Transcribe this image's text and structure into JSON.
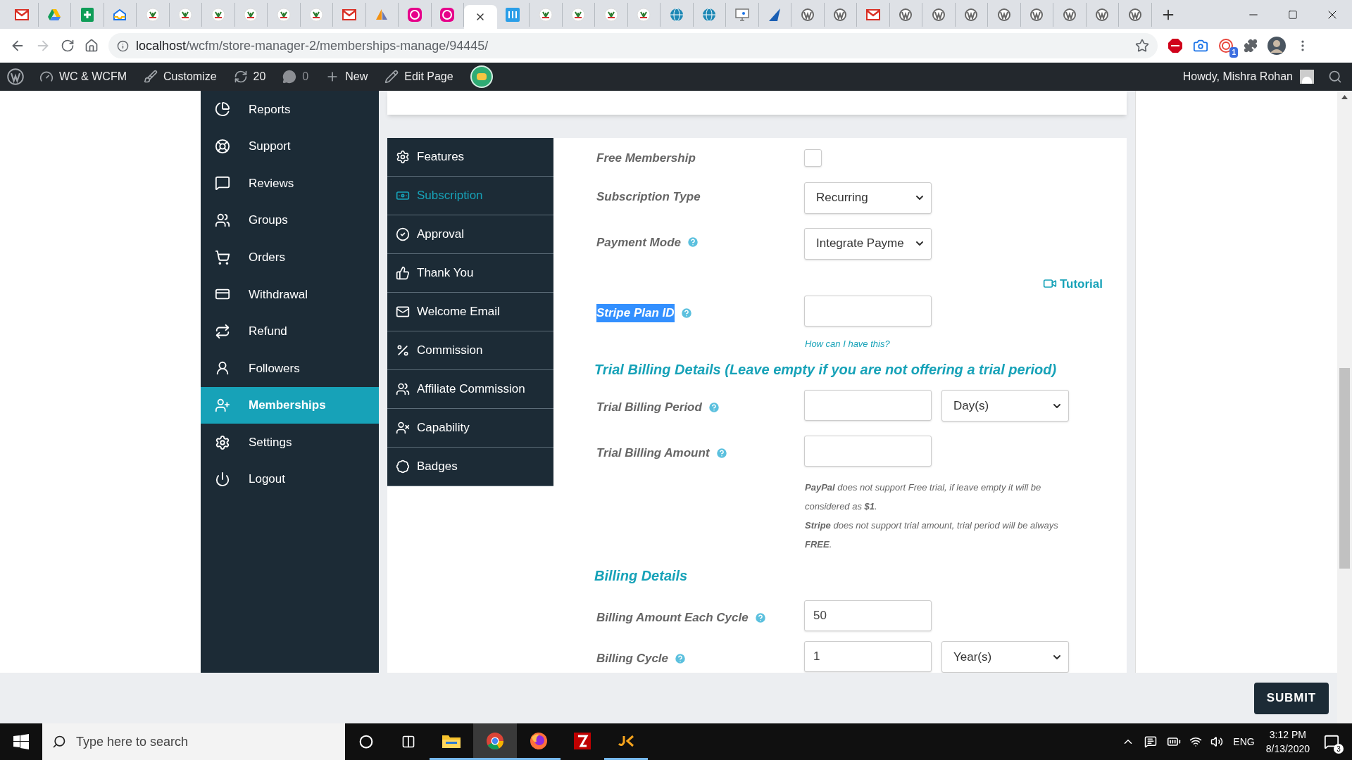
{
  "browser": {
    "tabs": [
      {
        "kind": "gmail",
        "selected": false
      },
      {
        "kind": "drive",
        "selected": false
      },
      {
        "kind": "sheets",
        "selected": false
      },
      {
        "kind": "inbox",
        "selected": false
      },
      {
        "kind": "wcfm",
        "selected": false
      },
      {
        "kind": "wcfm",
        "selected": false
      },
      {
        "kind": "wcfm",
        "selected": false
      },
      {
        "kind": "wcfm",
        "selected": false
      },
      {
        "kind": "wcfm",
        "selected": false
      },
      {
        "kind": "wcfm",
        "selected": false
      },
      {
        "kind": "gmail",
        "selected": false
      },
      {
        "kind": "pma",
        "selected": false
      },
      {
        "kind": "wamp",
        "selected": false
      },
      {
        "kind": "wamp",
        "selected": false
      },
      {
        "kind": "blank",
        "selected": true
      },
      {
        "kind": "ibb",
        "selected": false
      },
      {
        "kind": "wcfm",
        "selected": false
      },
      {
        "kind": "wcfm",
        "selected": false
      },
      {
        "kind": "wcfm",
        "selected": false
      },
      {
        "kind": "wcfm",
        "selected": false
      },
      {
        "kind": "globe",
        "selected": false
      },
      {
        "kind": "globe",
        "selected": false
      },
      {
        "kind": "monitor",
        "selected": false
      },
      {
        "kind": "arrow",
        "selected": false
      },
      {
        "kind": "wp",
        "selected": false
      },
      {
        "kind": "wp",
        "selected": false
      },
      {
        "kind": "gmail",
        "selected": false
      },
      {
        "kind": "wp",
        "selected": false
      },
      {
        "kind": "wp",
        "selected": false
      },
      {
        "kind": "wp",
        "selected": false
      },
      {
        "kind": "wp",
        "selected": false
      },
      {
        "kind": "wp",
        "selected": false
      },
      {
        "kind": "wp",
        "selected": false
      },
      {
        "kind": "wp",
        "selected": false
      },
      {
        "kind": "wp",
        "selected": false
      }
    ],
    "url_host": "localhost",
    "url_path": "/wcfm/store-manager-2/memberships-manage/94445/",
    "extension_badge": "1"
  },
  "admin_bar": {
    "items": [
      {
        "kind": "dashboard",
        "label": "WC & WCFM",
        "muted": false
      },
      {
        "kind": "brush",
        "label": "Customize",
        "muted": false
      },
      {
        "kind": "refresh",
        "label": "20",
        "muted": false
      },
      {
        "kind": "comment",
        "label": "0",
        "muted": true
      },
      {
        "kind": "plus",
        "label": "New",
        "muted": false
      },
      {
        "kind": "pencil",
        "label": "Edit Page",
        "muted": false
      }
    ],
    "greeting": "Howdy, Mishra Rohan"
  },
  "sidebar": {
    "items": [
      {
        "kind": "reports",
        "label": "Reports",
        "selected": false
      },
      {
        "kind": "support",
        "label": "Support",
        "selected": false
      },
      {
        "kind": "reviews",
        "label": "Reviews",
        "selected": false
      },
      {
        "kind": "groups",
        "label": "Groups",
        "selected": false
      },
      {
        "kind": "orders",
        "label": "Orders",
        "selected": false
      },
      {
        "kind": "withdrawal",
        "label": "Withdrawal",
        "selected": false
      },
      {
        "kind": "refund",
        "label": "Refund",
        "selected": false
      },
      {
        "kind": "followers",
        "label": "Followers",
        "selected": false
      },
      {
        "kind": "memberships",
        "label": "Memberships",
        "selected": true
      },
      {
        "kind": "settings",
        "label": "Settings",
        "selected": false
      },
      {
        "kind": "logout",
        "label": "Logout",
        "selected": false
      }
    ]
  },
  "settings_tabs": [
    {
      "kind": "features",
      "label": "Features",
      "selected": false
    },
    {
      "kind": "subscription",
      "label": "Subscription",
      "selected": true
    },
    {
      "kind": "approval",
      "label": "Approval",
      "selected": false
    },
    {
      "kind": "thanks",
      "label": "Thank You",
      "selected": false
    },
    {
      "kind": "email",
      "label": "Welcome Email",
      "selected": false
    },
    {
      "kind": "commission",
      "label": "Commission",
      "selected": false
    },
    {
      "kind": "affiliate",
      "label": "Affiliate Commission",
      "selected": false
    },
    {
      "kind": "capability",
      "label": "Capability",
      "selected": false
    },
    {
      "kind": "badges",
      "label": "Badges",
      "selected": false
    }
  ],
  "form": {
    "rows": [
      {
        "kind": "checkbox",
        "label": "Free Membership",
        "help": false,
        "checked": false
      },
      {
        "kind": "select",
        "label": "Subscription Type",
        "help": false,
        "value": "Recurring"
      },
      {
        "kind": "select",
        "label": "Payment Mode",
        "help": true,
        "value": "Integrate Payme"
      },
      {
        "kind": "link",
        "text": "Tutorial"
      },
      {
        "kind": "input",
        "label": "Stripe Plan ID",
        "help": true,
        "highlighted": true
      },
      {
        "kind": "hint",
        "text": "How can I have this?"
      },
      {
        "kind": "heading",
        "text": "Trial Billing Details (Leave empty if you are not offering a trial period)"
      },
      {
        "kind": "input_select",
        "label": "Trial Billing Period",
        "help": true,
        "option": "Day(s)"
      },
      {
        "kind": "input",
        "label": "Trial Billing Amount",
        "help": true,
        "highlighted": false
      },
      {
        "kind": "note",
        "lines": [
          "**PayPal** does not support Free trial, if leave empty it will be considered as **$1**.",
          "**Stripe** does not support trial amount, trial period will be always **FREE**."
        ]
      },
      {
        "kind": "heading",
        "text": "Billing Details"
      },
      {
        "kind": "input",
        "label": "Billing Amount Each Cycle",
        "help": true,
        "highlighted": false,
        "value": "50"
      },
      {
        "kind": "input_select",
        "label": "Billing Cycle",
        "help": true,
        "value": "1",
        "option": "Year(s)"
      }
    ]
  },
  "submit_button": "SUBMIT",
  "taskbar": {
    "search_placeholder": "Type here to search",
    "apps": [
      {
        "kind": "explorer",
        "selected": false,
        "running": true
      },
      {
        "kind": "chrome",
        "selected": true,
        "running": true
      },
      {
        "kind": "firefox",
        "selected": false,
        "running": true
      },
      {
        "kind": "filezilla",
        "selected": false,
        "running": false
      },
      {
        "kind": "jet",
        "selected": false,
        "running": true
      }
    ],
    "language": "ENG",
    "time": "3:12 PM",
    "date": "8/13/2020",
    "notification_count": "3"
  }
}
